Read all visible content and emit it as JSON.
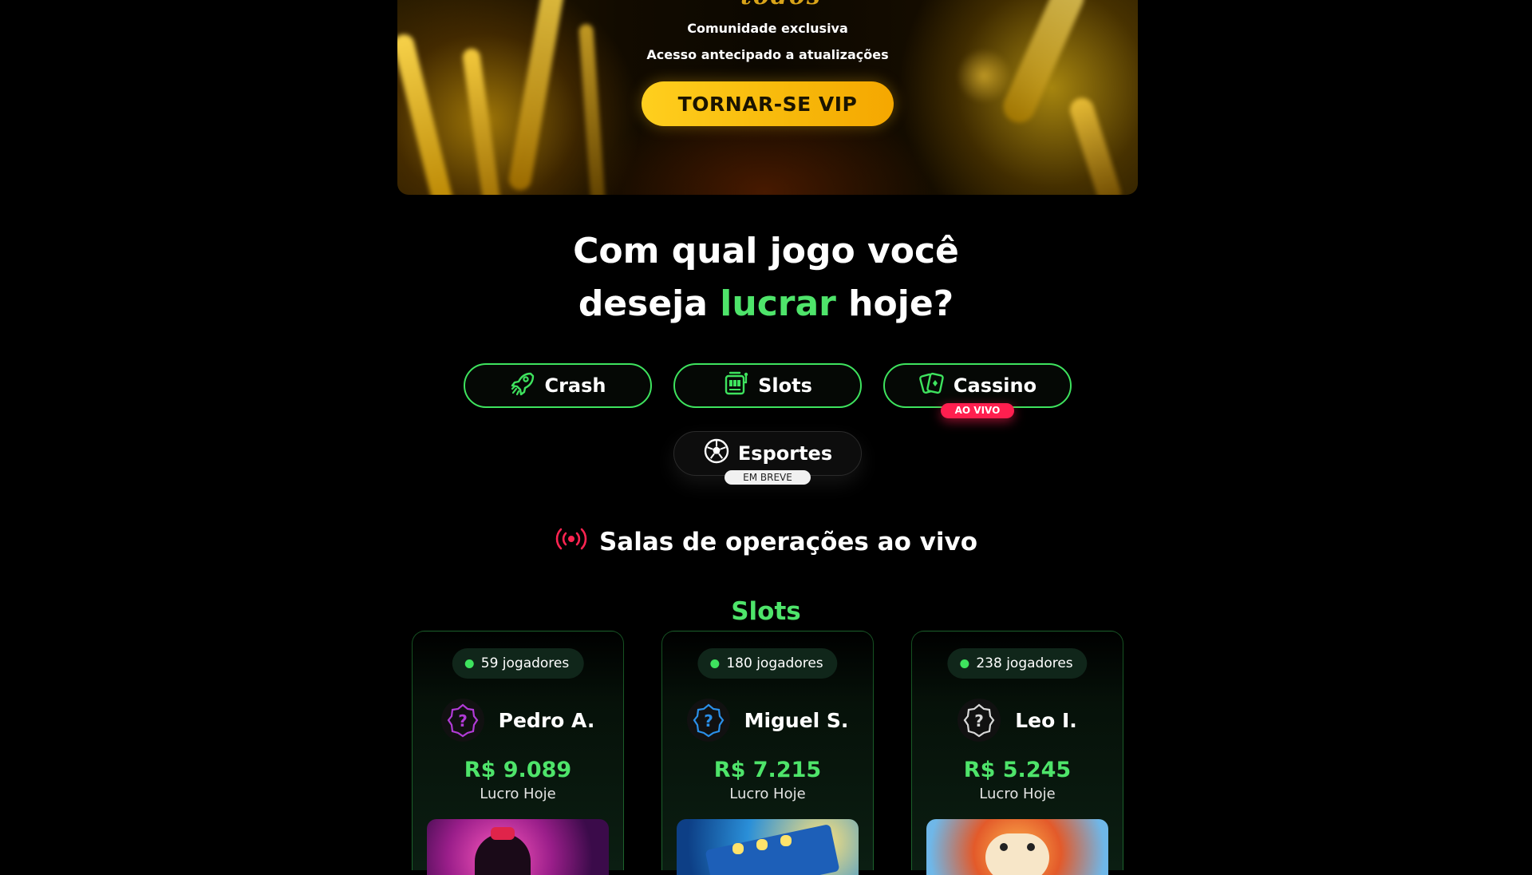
{
  "vip": {
    "heading_fragment": "todos",
    "line1": "Comunidade exclusiva",
    "line2": "Acesso antecipado a atualizações",
    "button": "TORNAR-SE VIP"
  },
  "heading": {
    "line1": "Com qual jogo você",
    "line2_before": "deseja ",
    "line2_accent": "lucrar",
    "line2_after": " hoje?"
  },
  "categories": [
    {
      "label": "Crash",
      "icon": "rocket-icon"
    },
    {
      "label": "Slots",
      "icon": "slot-machine-icon"
    },
    {
      "label": "Cassino",
      "icon": "cards-icon",
      "badge": "AO VIVO"
    },
    {
      "label": "Esportes",
      "icon": "soccer-ball-icon",
      "badge": "EM BREVE"
    }
  ],
  "live": {
    "title": "Salas de operações ao vivo",
    "icon": "broadcast-icon",
    "section": "Slots",
    "rooms": [
      {
        "players": "59 jogadores",
        "name": "Pedro A.",
        "profit": "R$ 9.089",
        "profit_label": "Lucro Hoje",
        "avatar_color": "#b13bd6"
      },
      {
        "players": "180 jogadores",
        "name": "Miguel S.",
        "profit": "R$ 7.215",
        "profit_label": "Lucro Hoje",
        "avatar_color": "#2a8fe8"
      },
      {
        "players": "238 jogadores",
        "name": "Leo I.",
        "profit": "R$ 5.245",
        "profit_label": "Lucro Hoje",
        "avatar_color": "#d8d8d8"
      }
    ]
  },
  "colors": {
    "accent": "#4ee46a",
    "live_badge": "#ff1f4f",
    "vip_button": "#ffc21a"
  }
}
